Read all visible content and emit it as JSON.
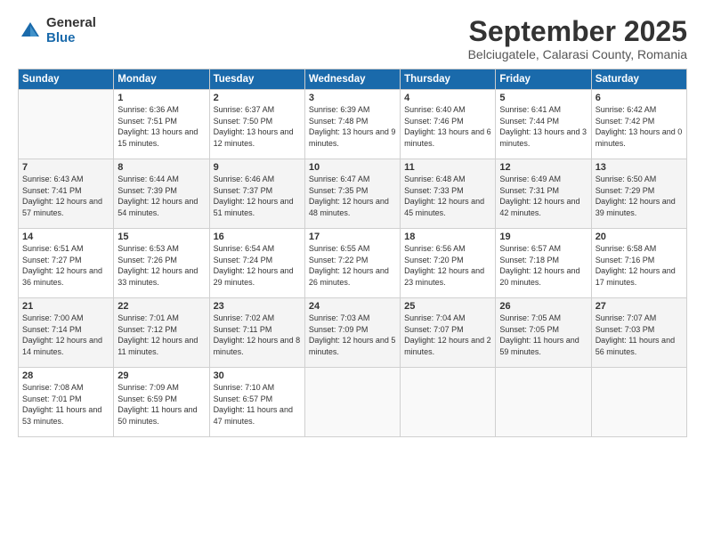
{
  "logo": {
    "general": "General",
    "blue": "Blue"
  },
  "header": {
    "title": "September 2025",
    "subtitle": "Belciugatele, Calarasi County, Romania"
  },
  "weekdays": [
    "Sunday",
    "Monday",
    "Tuesday",
    "Wednesday",
    "Thursday",
    "Friday",
    "Saturday"
  ],
  "weeks": [
    [
      {
        "day": "",
        "sunrise": "",
        "sunset": "",
        "daylight": ""
      },
      {
        "day": "1",
        "sunrise": "Sunrise: 6:36 AM",
        "sunset": "Sunset: 7:51 PM",
        "daylight": "Daylight: 13 hours and 15 minutes."
      },
      {
        "day": "2",
        "sunrise": "Sunrise: 6:37 AM",
        "sunset": "Sunset: 7:50 PM",
        "daylight": "Daylight: 13 hours and 12 minutes."
      },
      {
        "day": "3",
        "sunrise": "Sunrise: 6:39 AM",
        "sunset": "Sunset: 7:48 PM",
        "daylight": "Daylight: 13 hours and 9 minutes."
      },
      {
        "day": "4",
        "sunrise": "Sunrise: 6:40 AM",
        "sunset": "Sunset: 7:46 PM",
        "daylight": "Daylight: 13 hours and 6 minutes."
      },
      {
        "day": "5",
        "sunrise": "Sunrise: 6:41 AM",
        "sunset": "Sunset: 7:44 PM",
        "daylight": "Daylight: 13 hours and 3 minutes."
      },
      {
        "day": "6",
        "sunrise": "Sunrise: 6:42 AM",
        "sunset": "Sunset: 7:42 PM",
        "daylight": "Daylight: 13 hours and 0 minutes."
      }
    ],
    [
      {
        "day": "7",
        "sunrise": "Sunrise: 6:43 AM",
        "sunset": "Sunset: 7:41 PM",
        "daylight": "Daylight: 12 hours and 57 minutes."
      },
      {
        "day": "8",
        "sunrise": "Sunrise: 6:44 AM",
        "sunset": "Sunset: 7:39 PM",
        "daylight": "Daylight: 12 hours and 54 minutes."
      },
      {
        "day": "9",
        "sunrise": "Sunrise: 6:46 AM",
        "sunset": "Sunset: 7:37 PM",
        "daylight": "Daylight: 12 hours and 51 minutes."
      },
      {
        "day": "10",
        "sunrise": "Sunrise: 6:47 AM",
        "sunset": "Sunset: 7:35 PM",
        "daylight": "Daylight: 12 hours and 48 minutes."
      },
      {
        "day": "11",
        "sunrise": "Sunrise: 6:48 AM",
        "sunset": "Sunset: 7:33 PM",
        "daylight": "Daylight: 12 hours and 45 minutes."
      },
      {
        "day": "12",
        "sunrise": "Sunrise: 6:49 AM",
        "sunset": "Sunset: 7:31 PM",
        "daylight": "Daylight: 12 hours and 42 minutes."
      },
      {
        "day": "13",
        "sunrise": "Sunrise: 6:50 AM",
        "sunset": "Sunset: 7:29 PM",
        "daylight": "Daylight: 12 hours and 39 minutes."
      }
    ],
    [
      {
        "day": "14",
        "sunrise": "Sunrise: 6:51 AM",
        "sunset": "Sunset: 7:27 PM",
        "daylight": "Daylight: 12 hours and 36 minutes."
      },
      {
        "day": "15",
        "sunrise": "Sunrise: 6:53 AM",
        "sunset": "Sunset: 7:26 PM",
        "daylight": "Daylight: 12 hours and 33 minutes."
      },
      {
        "day": "16",
        "sunrise": "Sunrise: 6:54 AM",
        "sunset": "Sunset: 7:24 PM",
        "daylight": "Daylight: 12 hours and 29 minutes."
      },
      {
        "day": "17",
        "sunrise": "Sunrise: 6:55 AM",
        "sunset": "Sunset: 7:22 PM",
        "daylight": "Daylight: 12 hours and 26 minutes."
      },
      {
        "day": "18",
        "sunrise": "Sunrise: 6:56 AM",
        "sunset": "Sunset: 7:20 PM",
        "daylight": "Daylight: 12 hours and 23 minutes."
      },
      {
        "day": "19",
        "sunrise": "Sunrise: 6:57 AM",
        "sunset": "Sunset: 7:18 PM",
        "daylight": "Daylight: 12 hours and 20 minutes."
      },
      {
        "day": "20",
        "sunrise": "Sunrise: 6:58 AM",
        "sunset": "Sunset: 7:16 PM",
        "daylight": "Daylight: 12 hours and 17 minutes."
      }
    ],
    [
      {
        "day": "21",
        "sunrise": "Sunrise: 7:00 AM",
        "sunset": "Sunset: 7:14 PM",
        "daylight": "Daylight: 12 hours and 14 minutes."
      },
      {
        "day": "22",
        "sunrise": "Sunrise: 7:01 AM",
        "sunset": "Sunset: 7:12 PM",
        "daylight": "Daylight: 12 hours and 11 minutes."
      },
      {
        "day": "23",
        "sunrise": "Sunrise: 7:02 AM",
        "sunset": "Sunset: 7:11 PM",
        "daylight": "Daylight: 12 hours and 8 minutes."
      },
      {
        "day": "24",
        "sunrise": "Sunrise: 7:03 AM",
        "sunset": "Sunset: 7:09 PM",
        "daylight": "Daylight: 12 hours and 5 minutes."
      },
      {
        "day": "25",
        "sunrise": "Sunrise: 7:04 AM",
        "sunset": "Sunset: 7:07 PM",
        "daylight": "Daylight: 12 hours and 2 minutes."
      },
      {
        "day": "26",
        "sunrise": "Sunrise: 7:05 AM",
        "sunset": "Sunset: 7:05 PM",
        "daylight": "Daylight: 11 hours and 59 minutes."
      },
      {
        "day": "27",
        "sunrise": "Sunrise: 7:07 AM",
        "sunset": "Sunset: 7:03 PM",
        "daylight": "Daylight: 11 hours and 56 minutes."
      }
    ],
    [
      {
        "day": "28",
        "sunrise": "Sunrise: 7:08 AM",
        "sunset": "Sunset: 7:01 PM",
        "daylight": "Daylight: 11 hours and 53 minutes."
      },
      {
        "day": "29",
        "sunrise": "Sunrise: 7:09 AM",
        "sunset": "Sunset: 6:59 PM",
        "daylight": "Daylight: 11 hours and 50 minutes."
      },
      {
        "day": "30",
        "sunrise": "Sunrise: 7:10 AM",
        "sunset": "Sunset: 6:57 PM",
        "daylight": "Daylight: 11 hours and 47 minutes."
      },
      {
        "day": "",
        "sunrise": "",
        "sunset": "",
        "daylight": ""
      },
      {
        "day": "",
        "sunrise": "",
        "sunset": "",
        "daylight": ""
      },
      {
        "day": "",
        "sunrise": "",
        "sunset": "",
        "daylight": ""
      },
      {
        "day": "",
        "sunrise": "",
        "sunset": "",
        "daylight": ""
      }
    ]
  ]
}
